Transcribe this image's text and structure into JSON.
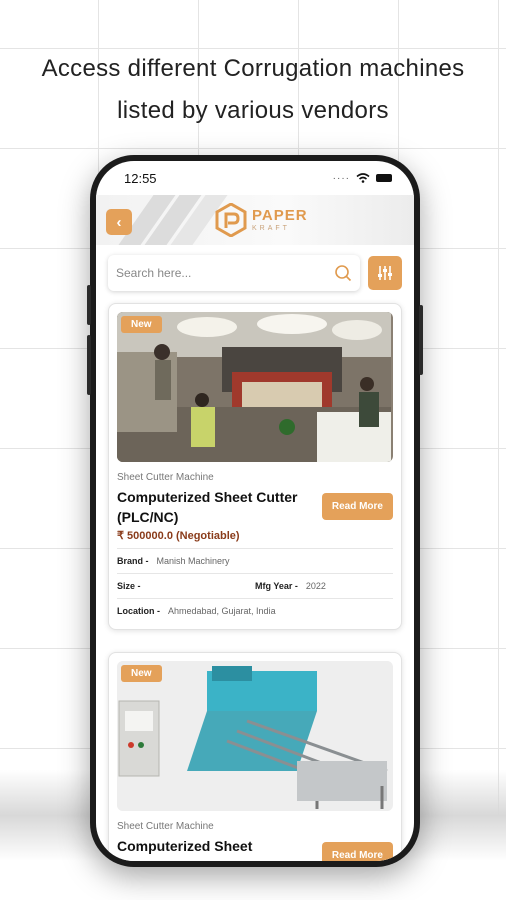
{
  "headline": {
    "line1": "Access different Corrugation machines",
    "line2": "listed by various vendors"
  },
  "status_bar": {
    "time": "12:55"
  },
  "app_bar": {
    "back_icon": "chevron-left-icon",
    "logo_main": "PAPER",
    "logo_sub": "KRAFT"
  },
  "search": {
    "placeholder": "Search here...",
    "value": ""
  },
  "colors": {
    "accent": "#e4a15a",
    "price": "#8a3b1a"
  },
  "listings": [
    {
      "badge": "New",
      "category": "Sheet Cutter Machine",
      "title": "Computerized Sheet Cutter (PLC/NC)",
      "price": "₹ 500000.0 (Negotiable)",
      "read_more": "Read More",
      "brand_label": "Brand -",
      "brand": "Manish Machinery",
      "size_label": "Size -",
      "size": "",
      "year_label": "Mfg Year -",
      "year": "2022",
      "location_label": "Location -",
      "location": "Ahmedabad, Gujarat, India"
    },
    {
      "badge": "New",
      "category": "Sheet Cutter Machine",
      "title": "Computerized Sheet",
      "read_more": "Read More"
    }
  ]
}
